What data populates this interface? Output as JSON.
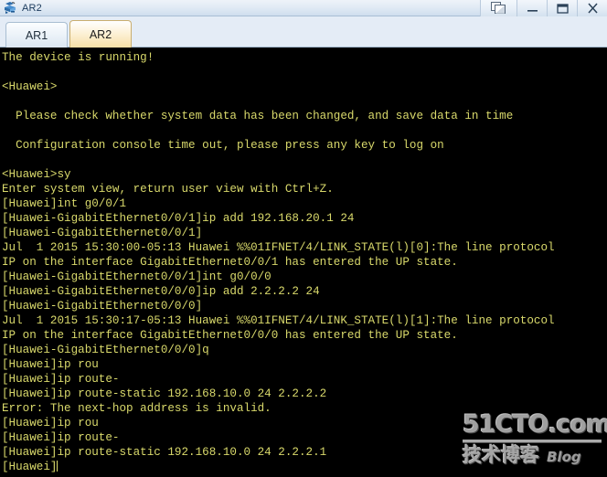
{
  "window": {
    "title": "AR2",
    "icon": "router-icon",
    "buttons": [
      {
        "name": "restore-pane-button",
        "label": "",
        "icon": "restore-pane-icon"
      },
      {
        "name": "minimize-button",
        "label": "_",
        "icon": "minimize-icon"
      },
      {
        "name": "maximize-button",
        "label": "",
        "icon": "maximize-icon"
      },
      {
        "name": "close-button",
        "label": "X",
        "icon": "close-icon"
      }
    ]
  },
  "tabs": [
    {
      "label": "AR1",
      "active": false
    },
    {
      "label": "AR2",
      "active": true
    }
  ],
  "terminal": {
    "foreground": "#d9d96b",
    "background": "#000000",
    "lines": [
      "The device is running!",
      "",
      "<Huawei>",
      "",
      "  Please check whether system data has been changed, and save data in time",
      "",
      "  Configuration console time out, please press any key to log on",
      "",
      "<Huawei>sy",
      "Enter system view, return user view with Ctrl+Z.",
      "[Huawei]int g0/0/1",
      "[Huawei-GigabitEthernet0/0/1]ip add 192.168.20.1 24",
      "[Huawei-GigabitEthernet0/0/1]",
      "Jul  1 2015 15:30:00-05:13 Huawei %%01IFNET/4/LINK_STATE(l)[0]:The line protocol",
      "IP on the interface GigabitEthernet0/0/1 has entered the UP state.",
      "[Huawei-GigabitEthernet0/0/1]int g0/0/0",
      "[Huawei-GigabitEthernet0/0/0]ip add 2.2.2.2 24",
      "[Huawei-GigabitEthernet0/0/0]",
      "Jul  1 2015 15:30:17-05:13 Huawei %%01IFNET/4/LINK_STATE(l)[1]:The line protocol",
      "IP on the interface GigabitEthernet0/0/0 has entered the UP state.",
      "[Huawei-GigabitEthernet0/0/0]q",
      "[Huawei]ip rou",
      "[Huawei]ip route-",
      "[Huawei]ip route-static 192.168.10.0 24 2.2.2.2",
      "Error: The next-hop address is invalid.",
      "[Huawei]ip rou",
      "[Huawei]ip route-",
      "[Huawei]ip route-static 192.168.10.0 24 2.2.2.1"
    ],
    "prompt": "[Huawei]"
  },
  "watermark": {
    "site": "51CTO.com",
    "chinese": "技术博客",
    "blog": "Blog"
  }
}
